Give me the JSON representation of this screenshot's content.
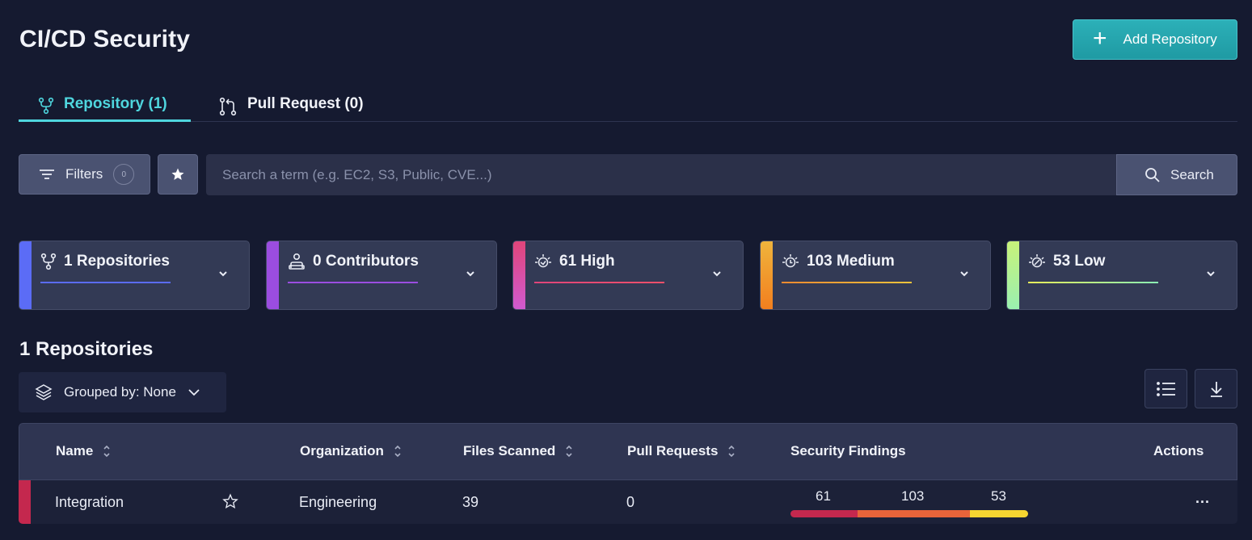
{
  "page": {
    "title": "CI/CD Security",
    "add_button_label": "Add Repository"
  },
  "tabs": [
    {
      "label": "Repository (1)",
      "active": true
    },
    {
      "label": "Pull Request (0)",
      "active": false
    }
  ],
  "filters": {
    "label": "Filters",
    "count": "0"
  },
  "search": {
    "placeholder": "Search a term (e.g. EC2, S3, Public, CVE...)",
    "value": "",
    "button_label": "Search"
  },
  "stats": [
    {
      "label": "1 Repositories",
      "icon": "fork-icon",
      "accent": "#5b6cf6",
      "underline": "#5b6cf6"
    },
    {
      "label": "0 Contributors",
      "icon": "contributor-icon",
      "accent": "#9b4de0",
      "underline": "#9b4de0"
    },
    {
      "label": "61 High",
      "icon": "bug-icon",
      "accent": "#e0457a",
      "underline": "#e0457a"
    },
    {
      "label": "103 Medium",
      "icon": "bug-icon",
      "accent": "#f39a2d",
      "underline": "#f0b43c"
    },
    {
      "label": "53 Low",
      "icon": "bug-icon",
      "accent": "#b9f28a",
      "underline": "#9cf0a8"
    }
  ],
  "section": {
    "title": "1 Repositories",
    "grouped_by": "Grouped by: None"
  },
  "table": {
    "columns": [
      "Name",
      "Organization",
      "Files Scanned",
      "Pull Requests",
      "Security Findings",
      "Actions"
    ],
    "rows": [
      {
        "name": "Integration",
        "organization": "Engineering",
        "files_scanned": "39",
        "pull_requests": "0",
        "findings": {
          "high": "61",
          "medium": "103",
          "low": "53"
        },
        "actions": "..."
      }
    ]
  },
  "colors": {
    "accent": "#4fd6de",
    "high": "#c4284e",
    "medium": "#e8643a",
    "low": "#f5d531"
  }
}
